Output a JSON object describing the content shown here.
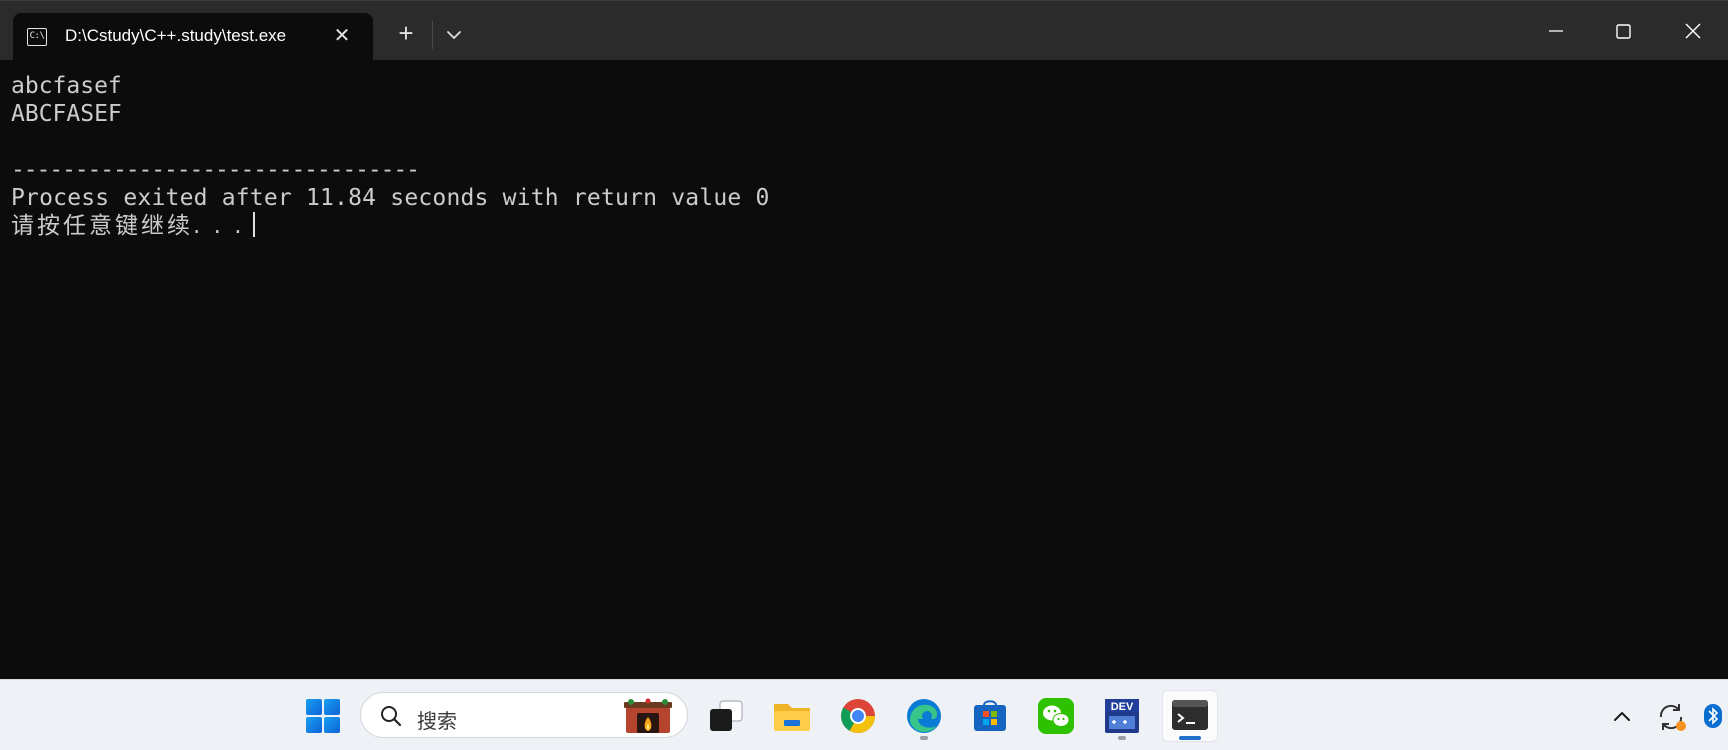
{
  "window": {
    "tab_icon_text": "C:\\",
    "tab_title": "D:\\Cstudy\\C++.study\\test.exe",
    "close_tab_glyph": "✕",
    "new_tab_glyph": "+"
  },
  "terminal": {
    "lines": [
      "abcfasef",
      "ABCFASEF",
      "",
      "--------------------------------",
      "Process exited after 11.84 seconds with return value 0",
      "请按任意键继续. . ."
    ],
    "foreground_color": "#cccccc",
    "background_color": "#0c0c0c"
  },
  "taskbar": {
    "search_placeholder": "搜索",
    "dev_icon_text": "DEV",
    "pinned": [
      {
        "name": "start",
        "icon": "windows-logo-icon"
      },
      {
        "name": "search",
        "icon": "search-icon"
      },
      {
        "name": "task-view",
        "icon": "task-view-icon"
      },
      {
        "name": "file-explorer",
        "icon": "folder-icon"
      },
      {
        "name": "chrome",
        "icon": "chrome-icon"
      },
      {
        "name": "edge",
        "icon": "edge-icon",
        "running": true
      },
      {
        "name": "microsoft-store",
        "icon": "store-icon"
      },
      {
        "name": "wechat",
        "icon": "wechat-icon"
      },
      {
        "name": "dev-cpp",
        "icon": "dev-cpp-icon",
        "running": true
      },
      {
        "name": "terminal",
        "icon": "terminal-icon",
        "active": true
      }
    ],
    "accent_color": "#1f6fcb"
  }
}
